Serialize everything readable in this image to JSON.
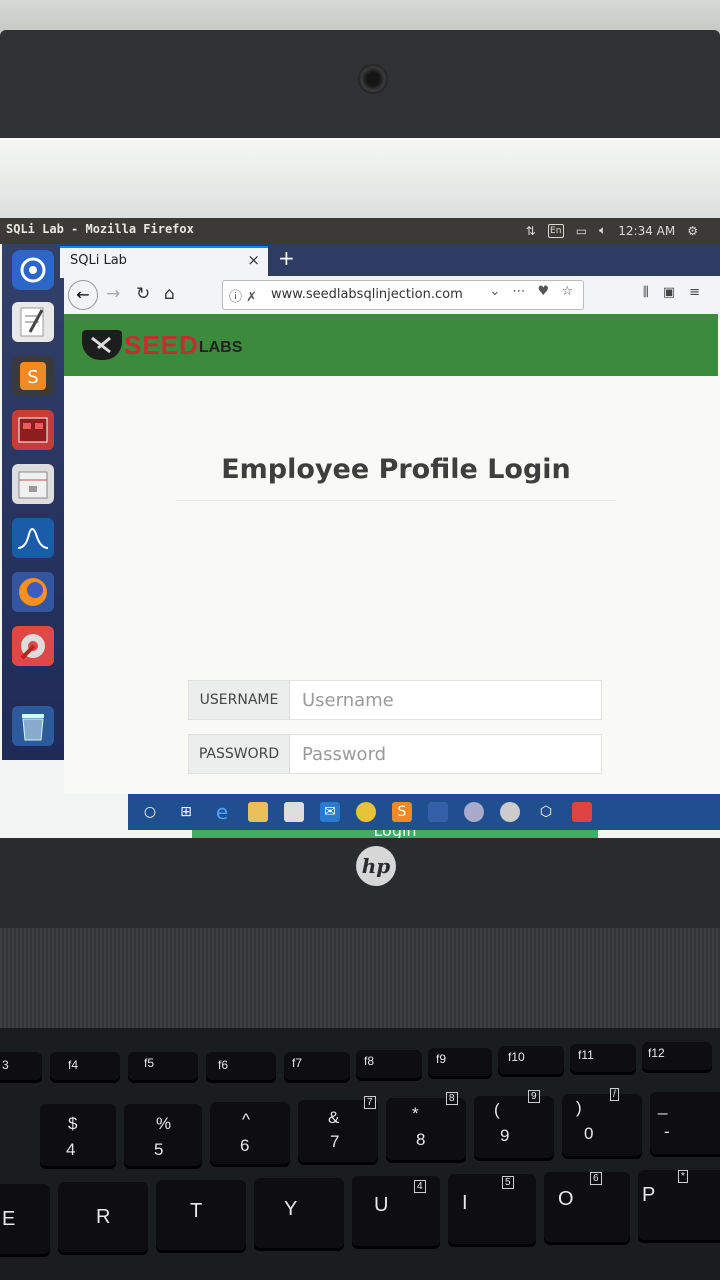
{
  "desktop": {
    "window_title": "SQLi Lab - Mozilla Firefox",
    "tray": {
      "lang": "En",
      "time": "12:34 AM"
    }
  },
  "browser": {
    "tab_title": "SQLi Lab",
    "tab_close": "×",
    "new_tab": "+",
    "url": "www.seedlabsqlinjection.com"
  },
  "page": {
    "logo_text_main": "SEED",
    "logo_text_sub": "LABS",
    "heading": "Employee Profile Login",
    "username_label": "USERNAME",
    "username_placeholder": "Username",
    "password_label": "PASSWORD",
    "password_placeholder": "Password",
    "login_button": "Login"
  },
  "laptop": {
    "brand": "hp",
    "fn_keys": [
      "3",
      "f4",
      "f5",
      "f6",
      "f7",
      "f8",
      "f9",
      "f10",
      "f11",
      "f12"
    ],
    "number_keys": [
      {
        "top": "$",
        "bottom": "4"
      },
      {
        "top": "%",
        "bottom": "5"
      },
      {
        "top": "^",
        "bottom": "6"
      },
      {
        "top": "&",
        "bottom": "7"
      },
      {
        "top": "*",
        "bottom": "8"
      },
      {
        "top": "(",
        "bottom": "9"
      },
      {
        "top": ")",
        "bottom": "0"
      },
      {
        "top": "_",
        "bottom": "-"
      }
    ],
    "numpad_marks": [
      "7",
      "8",
      "9",
      "/",
      "4",
      "5",
      "6",
      "*"
    ],
    "letter_keys": [
      "E",
      "R",
      "T",
      "Y",
      "U",
      "I",
      "O",
      "P"
    ]
  }
}
